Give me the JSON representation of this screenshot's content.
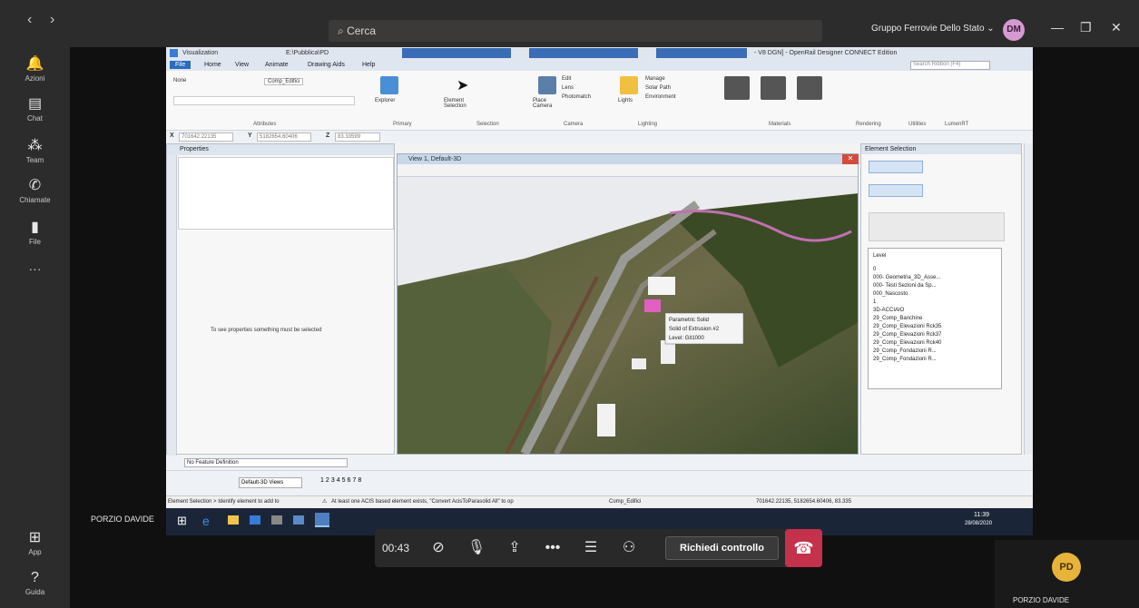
{
  "teams": {
    "search_placeholder": "Cerca",
    "org": "Gruppo Ferrovie Dello Stato ⌄",
    "user_initials": "DM",
    "rail": [
      "Azioni",
      "Chat",
      "Team",
      "Chiamate",
      "File",
      "···",
      "App",
      "Guida"
    ],
    "presenter": "PORZIO DAVIDE",
    "self_initials": "PD",
    "self_name": "PORZIO DAVIDE"
  },
  "call": {
    "timer": "00:43",
    "request_control": "Richiedi controllo"
  },
  "app": {
    "workflow": "Visualization",
    "path": "E:\\Pubblica\\PD",
    "title": "- V8 DGN] - OpenRail Designer CONNECT Edition",
    "search": "Search Ribbon (F4)",
    "tabs": [
      "File",
      "Home",
      "View",
      "Animate",
      "Drawing Aids",
      "Help"
    ],
    "ribbon": {
      "none": "None",
      "level": "Comp_Edifici",
      "explorer": "Explorer",
      "element_selection": "Element Selection",
      "edit": "Edit",
      "lens": "Lens",
      "photomatch": "Photomatch",
      "place_camera": "Place Camera",
      "lights": "Lights",
      "manage": "Manage",
      "solar_path": "Solar Path",
      "environment": "Environment",
      "groups": [
        "Attributes",
        "Primary",
        "Selection",
        "Camera",
        "Lighting",
        "Materials",
        "Rendering",
        "Utilities",
        "LumenRT"
      ]
    },
    "coords": {
      "x": "701642.22135",
      "y": "5182654.60406",
      "z": "83.33599"
    },
    "properties_title": "Properties",
    "properties_msg": "To see properties something must be selected",
    "view_title": "View 1, Default-3D",
    "tooltip": [
      "Parametric Solid",
      "Solid of Extrusion #2",
      "Level: Git1000"
    ],
    "element_selection_title": "Element Selection",
    "level_header": "Level",
    "levels": [
      "0",
      "000- Geometria_3D_Asse...",
      "000- Testi Sezioni da Sp...",
      "000_Nascosto",
      "1",
      "3D-ACCIAIO",
      "29_Comp_Banchine",
      "29_Comp_Elevazioni Rck35",
      "29_Comp_Elevazioni Rck37",
      "29_Comp_Elevazioni Rck40",
      "29_Comp_Fondazioni R...",
      "29_Comp_Fondazioni R..."
    ],
    "feature_def": "No Feature Definition",
    "views_combo": "Default-3D Views",
    "view_numbers": [
      "1",
      "2",
      "3",
      "4",
      "5",
      "6",
      "7",
      "8"
    ],
    "status_left": "Element Selection > Identify element to add to",
    "status_warn": "At least one ACIS based element exists, \"Convert AcisToParasolid All\" to op",
    "status_level": "Comp_Edifici",
    "status_coords": "701642.22135, 5182654.60406, 83.335",
    "clock_time": "11:39",
    "clock_date": "28/08/2020"
  }
}
